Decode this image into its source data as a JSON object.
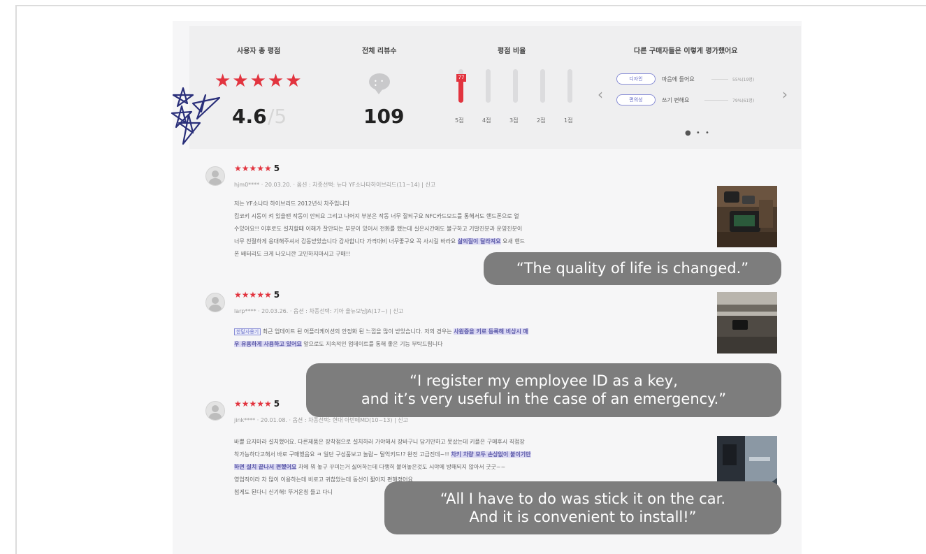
{
  "summary": {
    "rating_title": "사용자 총 평점",
    "rating_stars": "★★★★★",
    "rating_score": "4.6",
    "rating_max": "/5",
    "reviews_title": "전체 리뷰수",
    "reviews_count": "109",
    "ratio_title": "평점 비율",
    "ratio_flag": "77",
    "ratio_bars": [
      {
        "label": "5점",
        "fill": 0.77
      },
      {
        "label": "4점",
        "fill": 0
      },
      {
        "label": "3점",
        "fill": 0
      },
      {
        "label": "2점",
        "fill": 0
      },
      {
        "label": "1점",
        "fill": 0
      }
    ],
    "others_title": "다른 구매자들은 이렇게 평가했어요",
    "others": [
      {
        "chip": "디자인",
        "text": "마음에 들어요",
        "pct": "55%(19명)"
      },
      {
        "chip": "편의성",
        "text": "쓰기 편해요",
        "pct": "79%(61명)"
      }
    ],
    "prev_arrow": "‹",
    "next_arrow": "›",
    "pager_dots": "● • •"
  },
  "reviews": [
    {
      "stars": "★★★★★",
      "score": "5",
      "meta": "hjm0**** · 20.03.20. · 옵션 : 차종선택: 뉴다 YF소나타하이브리드(11~14) | 신고",
      "lines": [
        "저는 YF소나타 하이브리드 2012년식 차주입니다",
        "킵코키 시동이 켜 있을땐 작동이 안되요 그리고 나머지 부분은 작동 너무 잘되구요 NFC카드모드를 통해서도 핸드폰으로 열",
        "수있어요!! 이후로도 설치할때 이해가 잘안되는 부분이 있어서 전화를 했는데 실은시간에도 불구하고 기발진분과 운영진분이",
        "너무 친절하게 응대해주셔서 감동받았습니다 감사합니다 가격대비 너무좋구요 꼭 사시길 바라요",
        "폰 배터리도 크게 나오니깐 고민하지마시고 구매!!"
      ],
      "highlight": "삶의질이 달라져요",
      "highlight_tail": " 요새 핸드"
    },
    {
      "stars": "★★★★★",
      "score": "5",
      "meta": "larp**** · 20.03.26. · 옵션 : 차종선택: 기아 올뉴모닝JA(17~) | 신고",
      "tag": "한달사용기",
      "line1": " 최근 업데이트 된 어플리케이션의 안정화 된 느낌을 많이 받았습니다. 저의 경우는 ",
      "hl1": "사원증을 키로 등록해 비상시 매",
      "hl2": "우 유용하게 사용하고 있어요",
      "line2": " 앞으로도 지속적인 업데이트를 통해 좋은 기능 부탁드립니다"
    },
    {
      "stars": "★★★★★",
      "score": "5",
      "meta": "jink**** · 20.01.08. · 옵션 : 차종선택: 현대 아반떼MD(10~13) | 신고",
      "line1": "바쁠 요지마라 설치했어요. 다른제품은 장착점으로 설치하러 가야해서 장바구니 담기만하고 못샀는데 키플은 구매후시 직접장",
      "line2": "착가능하다고해서 바로 구매했음요 ㅋ 일단 구성품보고 놀람~ 탈억키드!? 완전 고급진데~!! ",
      "hl1": "차키 차량 모두 손상없이 붙이기만",
      "hl2": "하면 설치 끝나서 편했어요",
      "line3": " 차에 뭐 놓구 꾸미는거 싫어하는데 다행히 붙어놓은것도 시야에 방해되지 않아서 굿굿~~",
      "line4": "영업직이라 차 많이 이용하는데 비로고 귀찮았는데 동선이 짧아지 편해졌어요",
      "line5": "첨게도 된다니 신기해! 뚜거운칭 들고 다니"
    }
  ],
  "callouts": [
    [
      "“The quality of life is changed.”"
    ],
    [
      "“I register my employee ID as a key,",
      "and it’s very useful in the case of an emergency.”"
    ],
    [
      "“All I have to do was stick it on the car.",
      "And it is convenient to install!”"
    ]
  ],
  "colors": {
    "accent": "#e2343f",
    "highlight": "#dad8f3",
    "callout": "#7d7d7d"
  }
}
